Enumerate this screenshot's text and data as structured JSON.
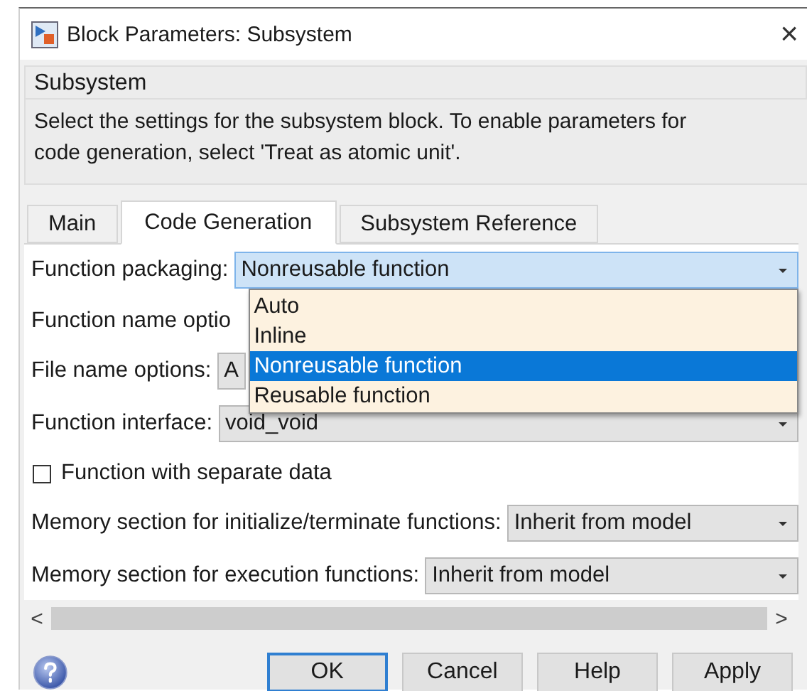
{
  "window": {
    "title": "Block Parameters: Subsystem",
    "close": "×"
  },
  "group": {
    "title": "Subsystem",
    "description": "Select the settings for the subsystem block. To enable parameters for code generation, select 'Treat as atomic unit'."
  },
  "tabs": [
    {
      "label": "Main",
      "selected": false
    },
    {
      "label": "Code Generation",
      "selected": true
    },
    {
      "label": "Subsystem Reference",
      "selected": false
    }
  ],
  "fields": [
    {
      "kind": "combo",
      "label": "Function packaging:",
      "value": "Nonreusable function",
      "expanded": true,
      "options": [
        {
          "label": "Auto",
          "selected": false
        },
        {
          "label": "Inline",
          "selected": false
        },
        {
          "label": "Nonreusable function",
          "selected": true
        },
        {
          "label": "Reusable function",
          "selected": false
        }
      ]
    },
    {
      "kind": "covered",
      "label": "Function name optio"
    },
    {
      "kind": "clipped_combo",
      "label": "File name options:",
      "value": "A"
    },
    {
      "kind": "combo",
      "label": "Function interface:",
      "value": "void_void",
      "expanded": false
    },
    {
      "kind": "checkbox",
      "label": "Function with separate data",
      "checked": false
    },
    {
      "kind": "combo",
      "label": "Memory section for initialize/terminate functions:",
      "value": "Inherit from model",
      "expanded": false
    },
    {
      "kind": "combo",
      "label": "Memory section for execution functions:",
      "value": "Inherit from model",
      "expanded": false
    }
  ],
  "scrollbar": {
    "left": "<",
    "right": ">"
  },
  "buttons": [
    {
      "label": "OK",
      "default": true
    },
    {
      "label": "Cancel",
      "default": false
    },
    {
      "label": "Help",
      "default": false
    },
    {
      "label": "Apply",
      "default": false
    }
  ]
}
